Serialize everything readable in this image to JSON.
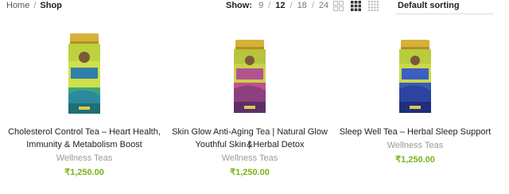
{
  "breadcrumb": {
    "home": "Home",
    "current": "Shop"
  },
  "show": {
    "label": "Show:",
    "options": [
      "9",
      "12",
      "18",
      "24"
    ],
    "active": "12"
  },
  "view_icons": [
    "grid-2-icon",
    "grid-3-icon",
    "grid-4-icon"
  ],
  "sort": {
    "selected": "Default sorting"
  },
  "colors": {
    "price": "#7ab317",
    "category": "#999999"
  },
  "products": [
    {
      "title_line1": "Cholesterol Control Tea – Heart Health,",
      "title_line2": "Immunity & Metabolism Boost",
      "category": "Wellness Teas",
      "price": "₹1,250.00",
      "label_text": "CHOLESTEROL CONTROL TEA"
    },
    {
      "title_line1": "Skin Glow Anti-Aging Tea | Natural Glow &",
      "title_line2": "Youthful Skin | Herbal Detox",
      "category": "Wellness Teas",
      "price": "₹1,250.00",
      "label_text": "SKIN GLOW ANTI AGING TEA"
    },
    {
      "title_line1": "Sleep Well Tea – Herbal Sleep Support",
      "title_line2": "",
      "category": "Wellness Teas",
      "price": "₹1,250.00",
      "label_text": "SLEEP WELL TEA"
    }
  ]
}
